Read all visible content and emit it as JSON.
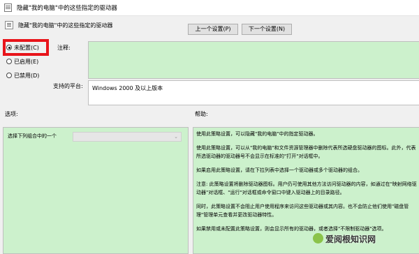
{
  "window": {
    "title": "隐藏\"我的电脑\"中的这些指定的驱动器"
  },
  "header": {
    "policy_name": "隐藏\"我的电脑\"中的这些指定的驱动器",
    "prev_button": "上一个设置(P)",
    "next_button": "下一个设置(N)"
  },
  "state_options": [
    {
      "label": "未配置(C)",
      "selected": true
    },
    {
      "label": "已启用(E)",
      "selected": false
    },
    {
      "label": "已禁用(D)",
      "selected": false
    }
  ],
  "comment": {
    "label": "注释:",
    "value": ""
  },
  "platform": {
    "label": "支持的平台:",
    "value": "Windows 2000 及以上版本"
  },
  "options": {
    "header": "选项:",
    "combo_label": "选择下列组合中的一个",
    "combo_value": ""
  },
  "help": {
    "header": "帮助:",
    "paragraphs": [
      "使用此策略设置，可以隐藏\"我的电脑\"中的指定驱动器。",
      "使用此策略设置，可以从\"我的电脑\"和文件资源管理器中删除代表所选硬盘驱动器的图标。此外，代表所选驱动器的驱动器号不会显示在标准的\"打开\"对话框中。",
      "如果启用此策略设置，请在下拉列表中选择一个驱动器或多个驱动器的组合。",
      "注意: 此策略设置将删除驱动器图标。用户仍可使用其他方法访问驱动器的内容，如通过在\"映射网络驱动器\"对话框、\"运行\"对话框或命令窗口中键入驱动器上的目录路径。",
      "同时，此策略设置不会阻止用户使用程序来访问这些驱动器或其内容。也不会防止他们使用\"磁盘管理\"管理单元查看并更改驱动器特性。",
      "如果禁用或未配置此策略设置，则会显示所有的驱动器，或者选择\"不限制驱动器\"选项。"
    ]
  },
  "watermark": "爱阅根知识网"
}
